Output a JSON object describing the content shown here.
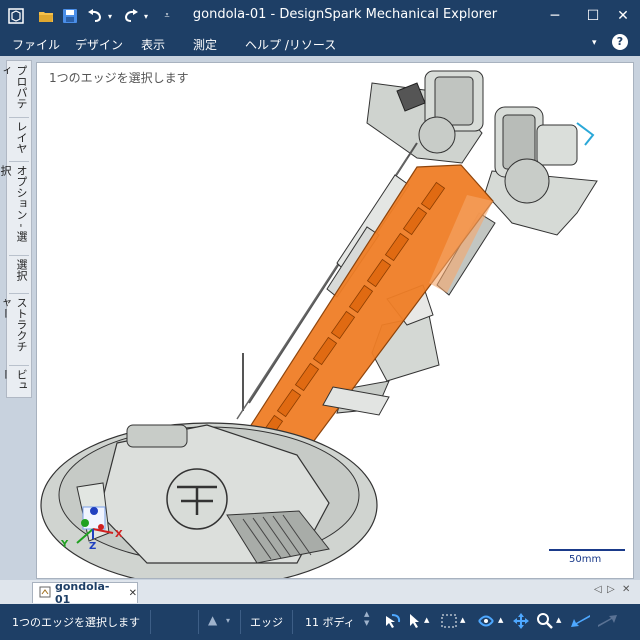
{
  "window": {
    "title": "gondola-01 - DesignSpark Mechanical Explorer",
    "minimize": "─",
    "maximize": "☐",
    "close": "✕",
    "help": "?"
  },
  "menu": {
    "items": [
      "ファイル",
      "デザイン",
      "表示",
      "測定",
      "ヘルプ /リソース"
    ]
  },
  "side_panel": {
    "tabs": [
      "プロパティ",
      "レイヤ",
      "オプション - 選択",
      "選択",
      "ストラクチャー",
      "ビュー"
    ]
  },
  "viewport": {
    "status_message": "1つのエッジを選択します",
    "scale_label": "50mm",
    "axis_labels": {
      "x": "X",
      "y": "Y",
      "z": "Z"
    }
  },
  "document_tabs": {
    "active": "gondola-01",
    "close": "✕"
  },
  "statusbar": {
    "message": "1つのエッジを選択します",
    "selection_filter": "エッジ",
    "body_count": "11 ボディ"
  },
  "colors": {
    "chrome": "#1e3f66",
    "selection": "#f07e26",
    "model": "#d4d8d4"
  }
}
